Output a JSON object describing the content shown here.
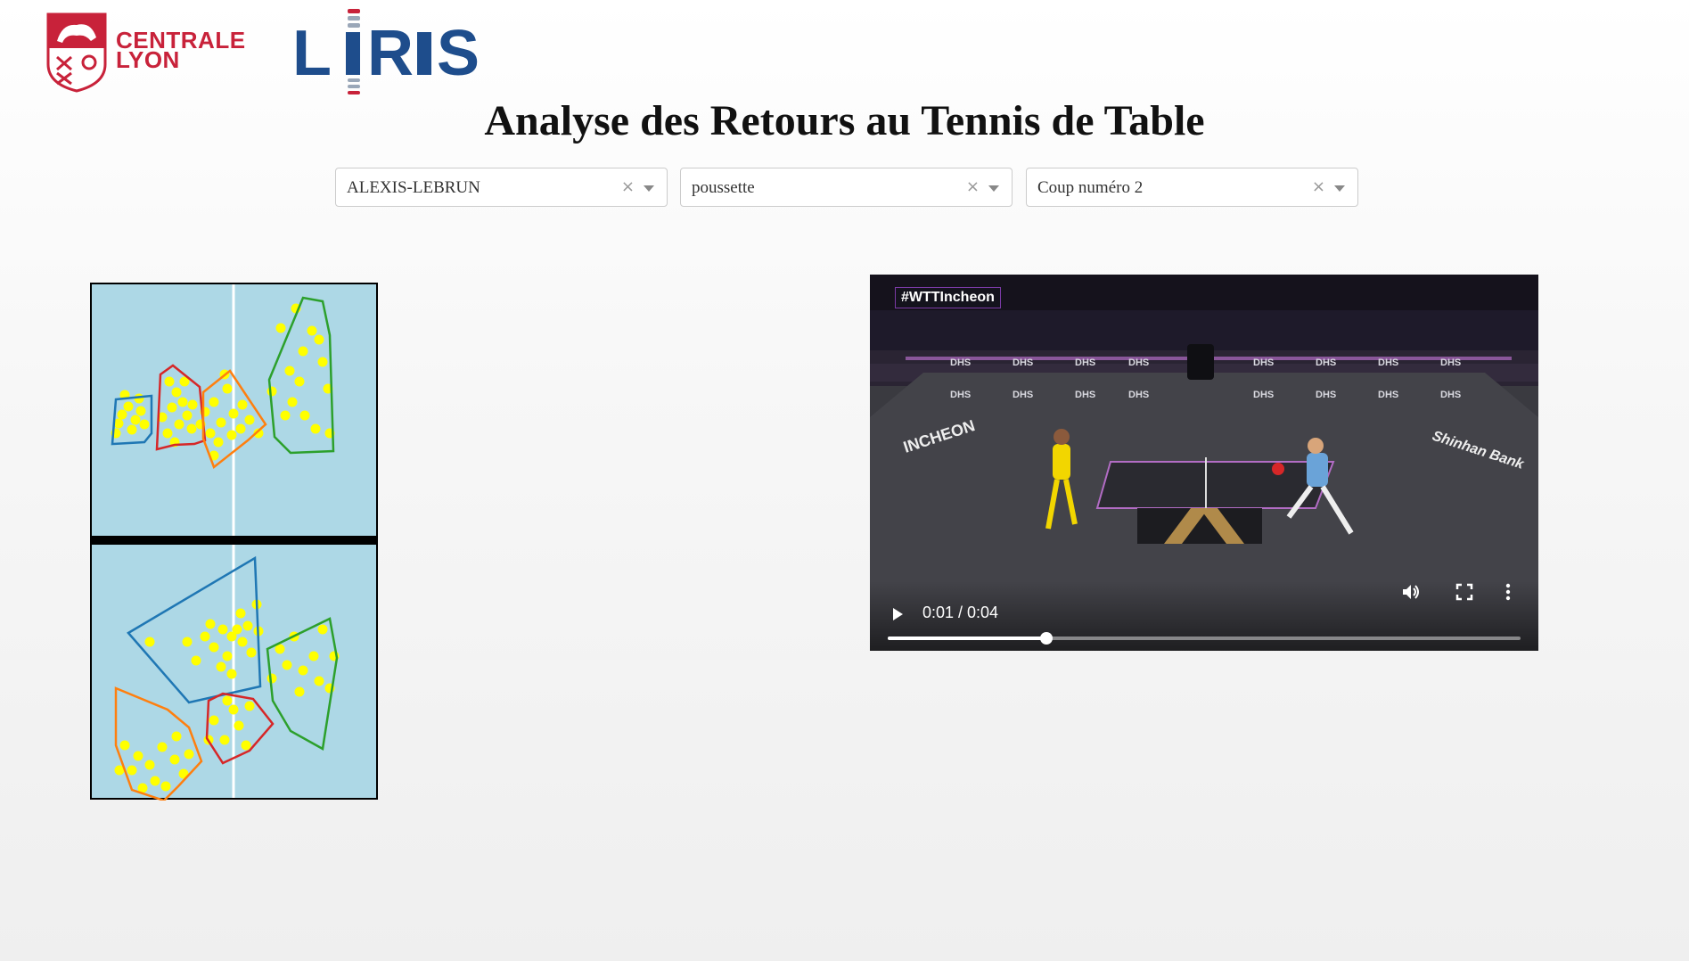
{
  "header": {
    "centrale_logo_text": "CENTRALE\nLYON",
    "liris_logo_text": "LIRIS",
    "title": "Analyse des Retours au Tennis de Table"
  },
  "filters": [
    {
      "value": "ALEXIS-LEBRUN",
      "clear": "×"
    },
    {
      "value": "poussette",
      "clear": "×"
    },
    {
      "value": "Coup numéro 2",
      "clear": "×"
    }
  ],
  "court": {
    "background_color": "#add8e6",
    "point_color": "#ffff00",
    "zone_colors": [
      "#1f77b4",
      "#d62728",
      "#ff7f0e",
      "#2ca02c"
    ]
  },
  "video": {
    "hashtag": "#WTTIncheon",
    "time_display": "0:01 / 0:04",
    "progress_fraction": 0.25,
    "icons": [
      "play-icon",
      "volume-icon",
      "fullscreen-icon",
      "more-options-icon"
    ]
  }
}
